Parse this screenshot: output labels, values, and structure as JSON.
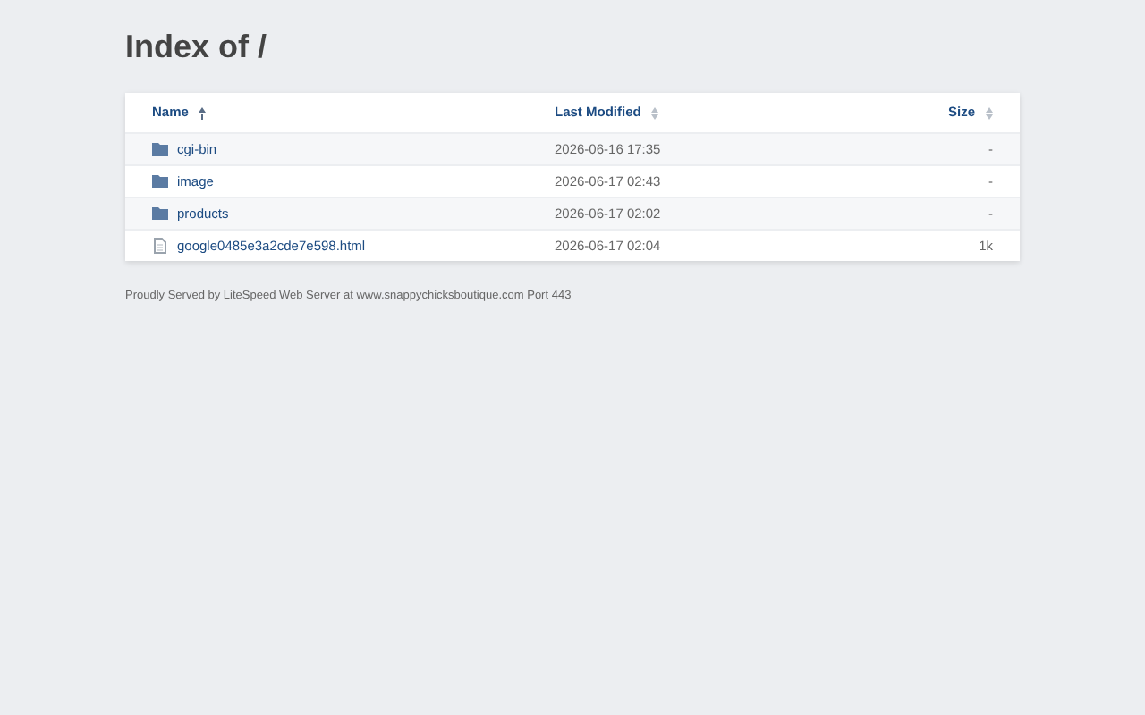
{
  "title": "Index of /",
  "columns": [
    {
      "label": "Name",
      "sorted": true
    },
    {
      "label": "Last Modified",
      "sorted": false
    },
    {
      "label": "Size",
      "sorted": false
    }
  ],
  "rows": [
    {
      "kind": "folder",
      "name": "cgi-bin",
      "modified": "2026-06-16 17:35",
      "size": "-"
    },
    {
      "kind": "folder",
      "name": "image",
      "modified": "2026-06-17 02:43",
      "size": "-"
    },
    {
      "kind": "folder",
      "name": "products",
      "modified": "2026-06-17 02:02",
      "size": "-"
    },
    {
      "kind": "file",
      "name": "google0485e3a2cde7e598.html",
      "modified": "2026-06-17 02:04",
      "size": "1k"
    }
  ],
  "footer": "Proudly Served by LiteSpeed Web Server at www.snappychicksboutique.com Port 443"
}
